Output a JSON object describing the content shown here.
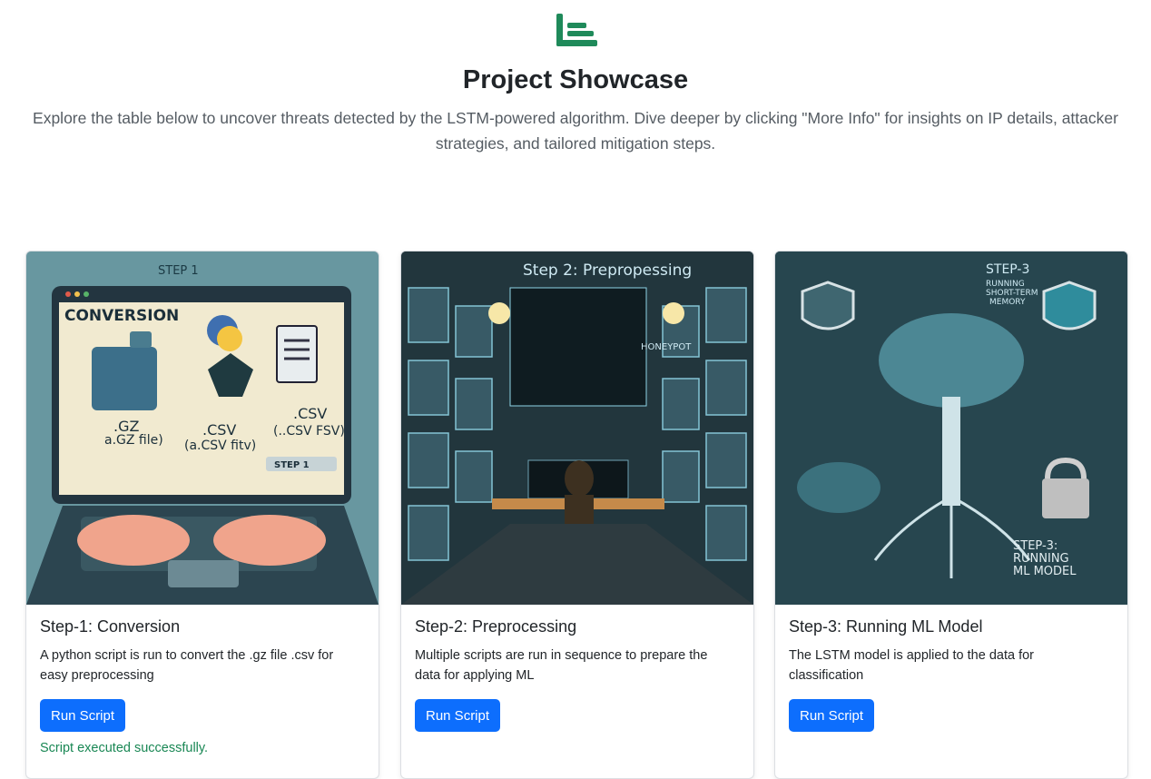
{
  "header": {
    "logo_icon": "green-list-logo-icon",
    "title": "Project Showcase",
    "description": "Explore the table below to uncover threats detected by the LSTM-powered algorithm. Dive deeper by clicking \"More Info\" for insights on IP details, attacker strategies, and tailored mitigation steps."
  },
  "colors": {
    "primary_button": "#0d6efd",
    "success_text": "#198754",
    "logo": "#1f8a5a"
  },
  "cards": [
    {
      "art": {
        "banner": "STEP 1",
        "heading": "CONVERSION",
        "gz": ".GZ",
        "gz_caption": "a.GZ file)",
        "csv": ".CSV",
        "csv_caption": "(a.CSV fitv)",
        "csv2": ".CSV",
        "csv2_caption": "(..CSV FSV)",
        "badge": "STEP 1"
      },
      "title": "Step-1: Conversion",
      "text": "A python script is run to convert the .gz file .csv for easy preprocessing",
      "button": "Run Script",
      "status": "Script executed successfully."
    },
    {
      "art": {
        "heading": "Step 2: Prepropessing",
        "label": "HONEYPOT"
      },
      "title": "Step-2: Preprocessing",
      "text": "Multiple scripts are run in sequence to prepare the data for applying ML",
      "button": "Run Script",
      "status": ""
    },
    {
      "art": {
        "heading": "STEP-3",
        "sub1": "RUNNING",
        "sub2": "SHORT-TERM",
        "sub3": "MEMORY",
        "foot1": "STEP-3:",
        "foot2": "RUNNING",
        "foot3": "ML MODEL"
      },
      "title": "Step-3: Running ML Model",
      "text": "The LSTM model is applied to the data for classification",
      "button": "Run Script",
      "status": ""
    }
  ]
}
